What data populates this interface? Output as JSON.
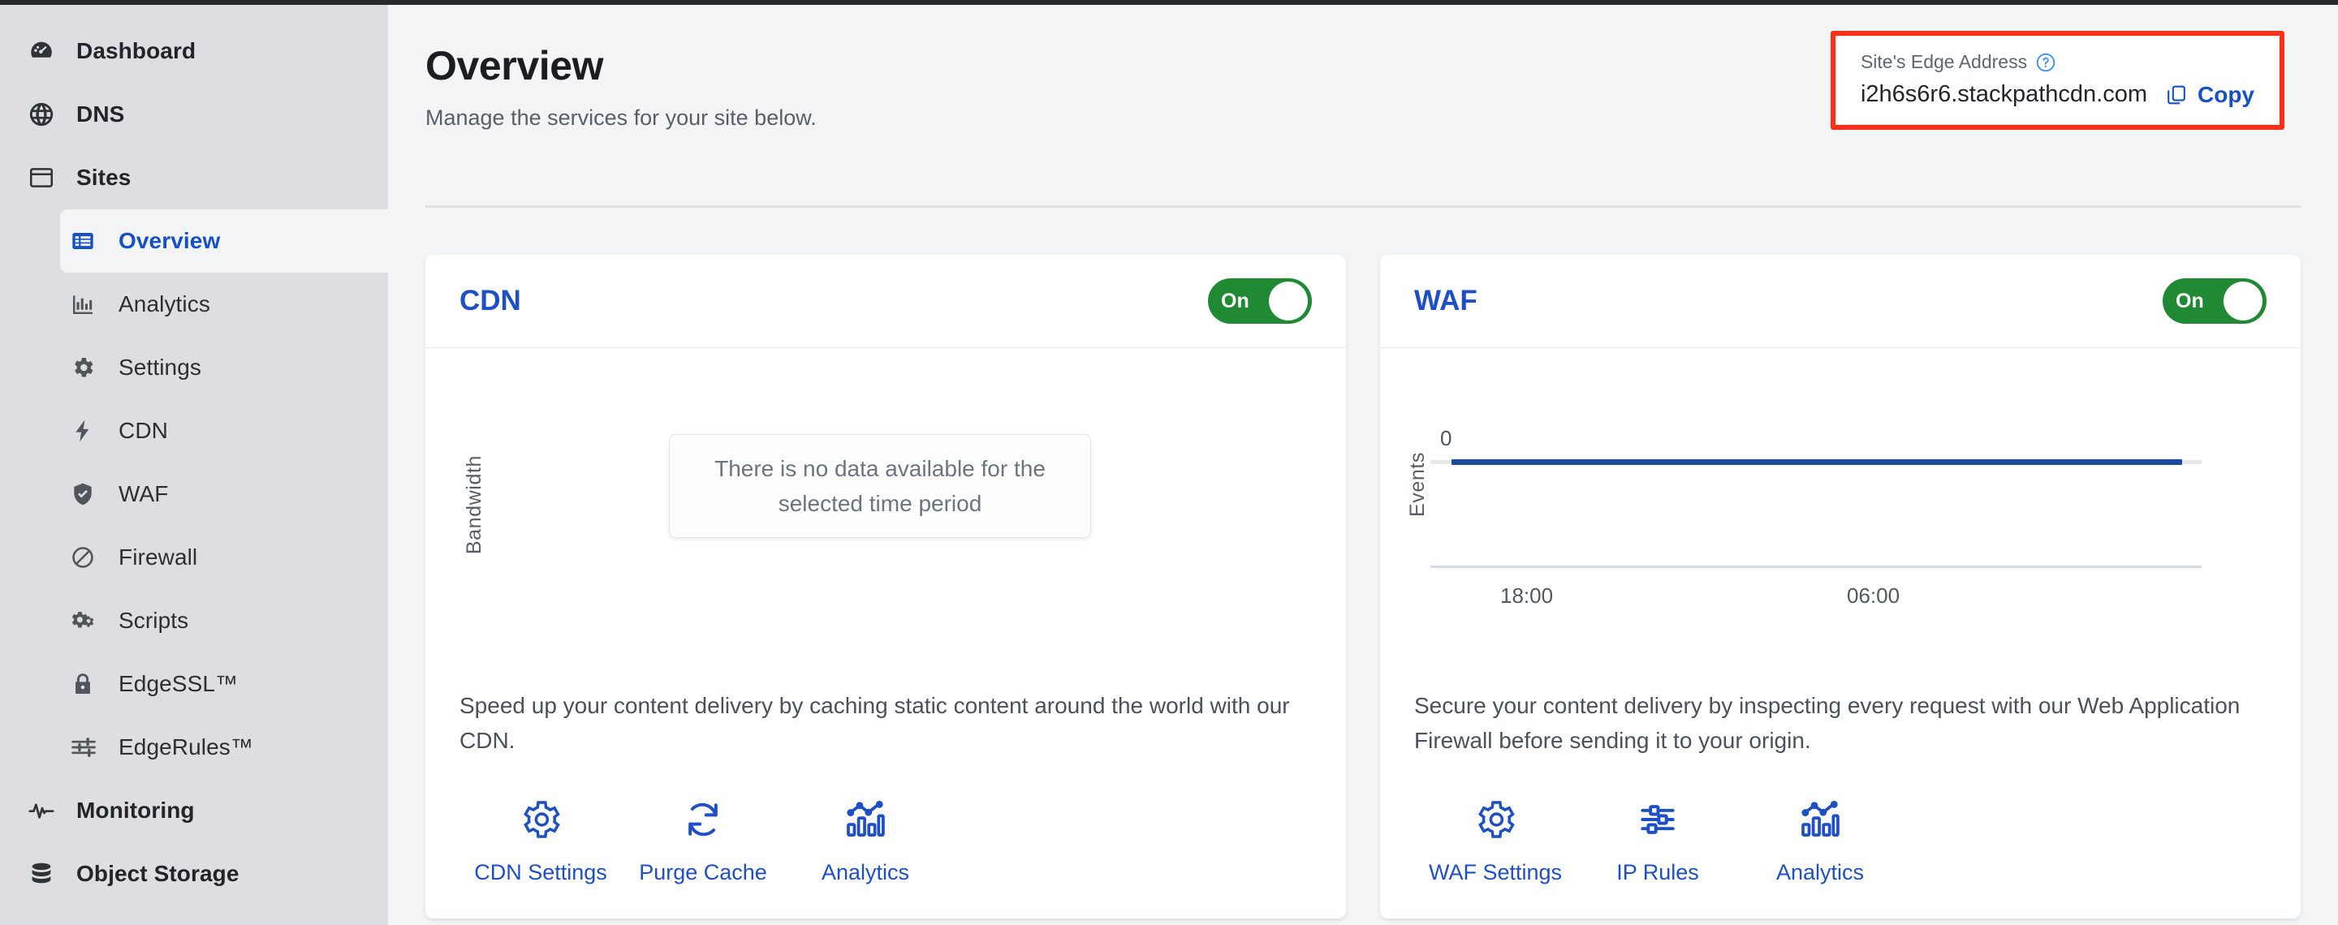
{
  "sidebar": {
    "items": [
      {
        "label": "Dashboard",
        "icon": "dashboard-gauge-icon",
        "level": "top",
        "active": false
      },
      {
        "label": "DNS",
        "icon": "globe-icon",
        "level": "top",
        "active": false
      },
      {
        "label": "Sites",
        "icon": "window-icon",
        "level": "top",
        "active": false
      },
      {
        "label": "Overview",
        "icon": "list-view-icon",
        "level": "sub",
        "active": true
      },
      {
        "label": "Analytics",
        "icon": "bar-chart-icon",
        "level": "sub",
        "active": false
      },
      {
        "label": "Settings",
        "icon": "gear-icon",
        "level": "sub",
        "active": false
      },
      {
        "label": "CDN",
        "icon": "bolt-icon",
        "level": "sub",
        "active": false
      },
      {
        "label": "WAF",
        "icon": "shield-check-icon",
        "level": "sub",
        "active": false
      },
      {
        "label": "Firewall",
        "icon": "block-circle-icon",
        "level": "sub",
        "active": false
      },
      {
        "label": "Scripts",
        "icon": "cogs-icon",
        "level": "sub",
        "active": false
      },
      {
        "label": "EdgeSSL™",
        "icon": "lock-icon",
        "level": "sub",
        "active": false
      },
      {
        "label": "EdgeRules™",
        "icon": "sliders-icon",
        "level": "sub",
        "active": false
      },
      {
        "label": "Monitoring",
        "icon": "pulse-icon",
        "level": "top",
        "active": false
      },
      {
        "label": "Object Storage",
        "icon": "database-icon",
        "level": "top",
        "active": false
      }
    ]
  },
  "header": {
    "title": "Overview",
    "subtitle": "Manage the services for your site below."
  },
  "edge_address": {
    "label": "Site's Edge Address",
    "help_icon": "help-circle-icon",
    "value": "i2h6s6r6.stackpathcdn.com",
    "copy_label": "Copy",
    "copy_icon": "copy-icon",
    "highlight_color": "#fb3019"
  },
  "cards": [
    {
      "title": "CDN",
      "toggle_label": "On",
      "toggle_state": "on",
      "toggle_color": "#1f8a33",
      "chart": {
        "y_axis_label": "Bandwidth",
        "empty_message": "There is no data available for the selected time period"
      },
      "description": "Speed up your content delivery by caching static content around the world with our CDN.",
      "actions": [
        {
          "label": "CDN Settings",
          "icon": "gear-icon"
        },
        {
          "label": "Purge Cache",
          "icon": "refresh-cycle-icon"
        },
        {
          "label": "Analytics",
          "icon": "analytics-chart-icon"
        }
      ]
    },
    {
      "title": "WAF",
      "toggle_label": "On",
      "toggle_state": "on",
      "toggle_color": "#1f8a33",
      "chart": {
        "y_axis_label": "Events",
        "y_tick": "0",
        "x_ticks": [
          "18:00",
          "06:00"
        ]
      },
      "description": "Secure your content delivery by inspecting every request with our Web Application Firewall before sending it to your origin.",
      "actions": [
        {
          "label": "WAF Settings",
          "icon": "gear-icon"
        },
        {
          "label": "IP Rules",
          "icon": "sliders-icon"
        },
        {
          "label": "Analytics",
          "icon": "analytics-chart-icon"
        }
      ]
    }
  ],
  "chart_data": [
    {
      "type": "line",
      "title": "CDN Bandwidth",
      "ylabel": "Bandwidth",
      "xlabel": "",
      "x": [],
      "values": [],
      "annotations": [
        "There is no data available for the selected time period"
      ],
      "grid": false,
      "legend": "none"
    },
    {
      "type": "line",
      "title": "WAF Events",
      "ylabel": "Events",
      "xlabel": "",
      "x": [
        "18:00",
        "06:00"
      ],
      "yticks": [
        "0"
      ],
      "ylim": [
        0,
        0
      ],
      "series": [
        {
          "name": "Events",
          "values": [
            0,
            0
          ],
          "color": "#1b4a9e"
        }
      ],
      "grid": false,
      "legend": "none"
    }
  ]
}
